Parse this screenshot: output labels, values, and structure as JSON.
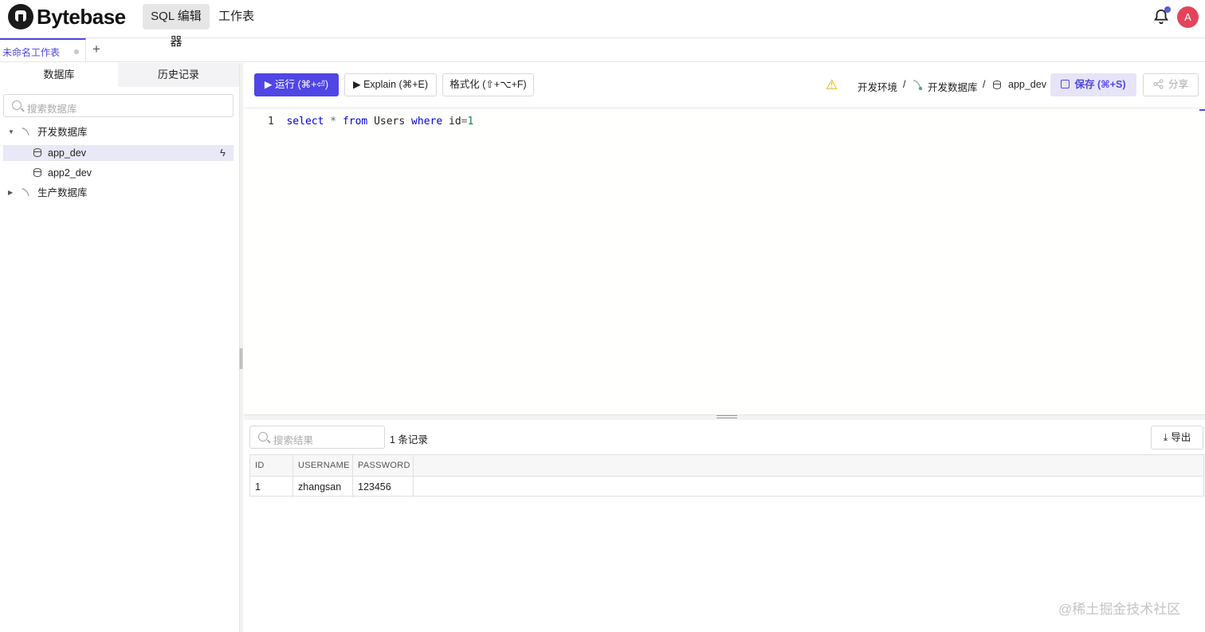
{
  "app": {
    "name": "Bytebase"
  },
  "nav": {
    "sql_editor": "SQL 编辑器",
    "worksheet": "工作表",
    "avatar": "A"
  },
  "tab": {
    "title": "未命名工作表",
    "add": "+"
  },
  "sidebar": {
    "tabs": [
      "数据库",
      "历史记录"
    ],
    "search_placeholder": "搜索数据库",
    "tree": [
      {
        "label": "开发数据库",
        "type": "instance",
        "expanded": true
      },
      {
        "label": "app_dev",
        "type": "database",
        "selected": true
      },
      {
        "label": "app2_dev",
        "type": "database"
      },
      {
        "label": "生产数据库",
        "type": "instance",
        "expanded": false
      }
    ]
  },
  "toolbar": {
    "run": "▶ 运行 (⌘+⏎)",
    "explain": "▶ Explain (⌘+E)",
    "format": "格式化 (⇧+⌥+F)",
    "environment": "开发环境",
    "separator": "/",
    "instance": "开发数据库",
    "database": "app_dev",
    "save": "保存 (⌘+S)",
    "share": "分享"
  },
  "editor": {
    "line_no": "1",
    "tokens": {
      "select": "select",
      "star": "*",
      "from": "from",
      "table": "Users",
      "where": "where",
      "col": "id",
      "eq": "=",
      "val": "1"
    }
  },
  "results": {
    "search_placeholder": "搜索结果",
    "count": "1 条记录",
    "export": "导出",
    "columns": [
      "ID",
      "USERNAME",
      "PASSWORD"
    ],
    "rows": [
      [
        "1",
        "zhangsan",
        "123456"
      ]
    ]
  },
  "watermark": "@稀土掘金技术社区",
  "colors": {
    "accent": "#4f46e5",
    "avatar": "#e3445a",
    "warning": "#e0b000"
  }
}
